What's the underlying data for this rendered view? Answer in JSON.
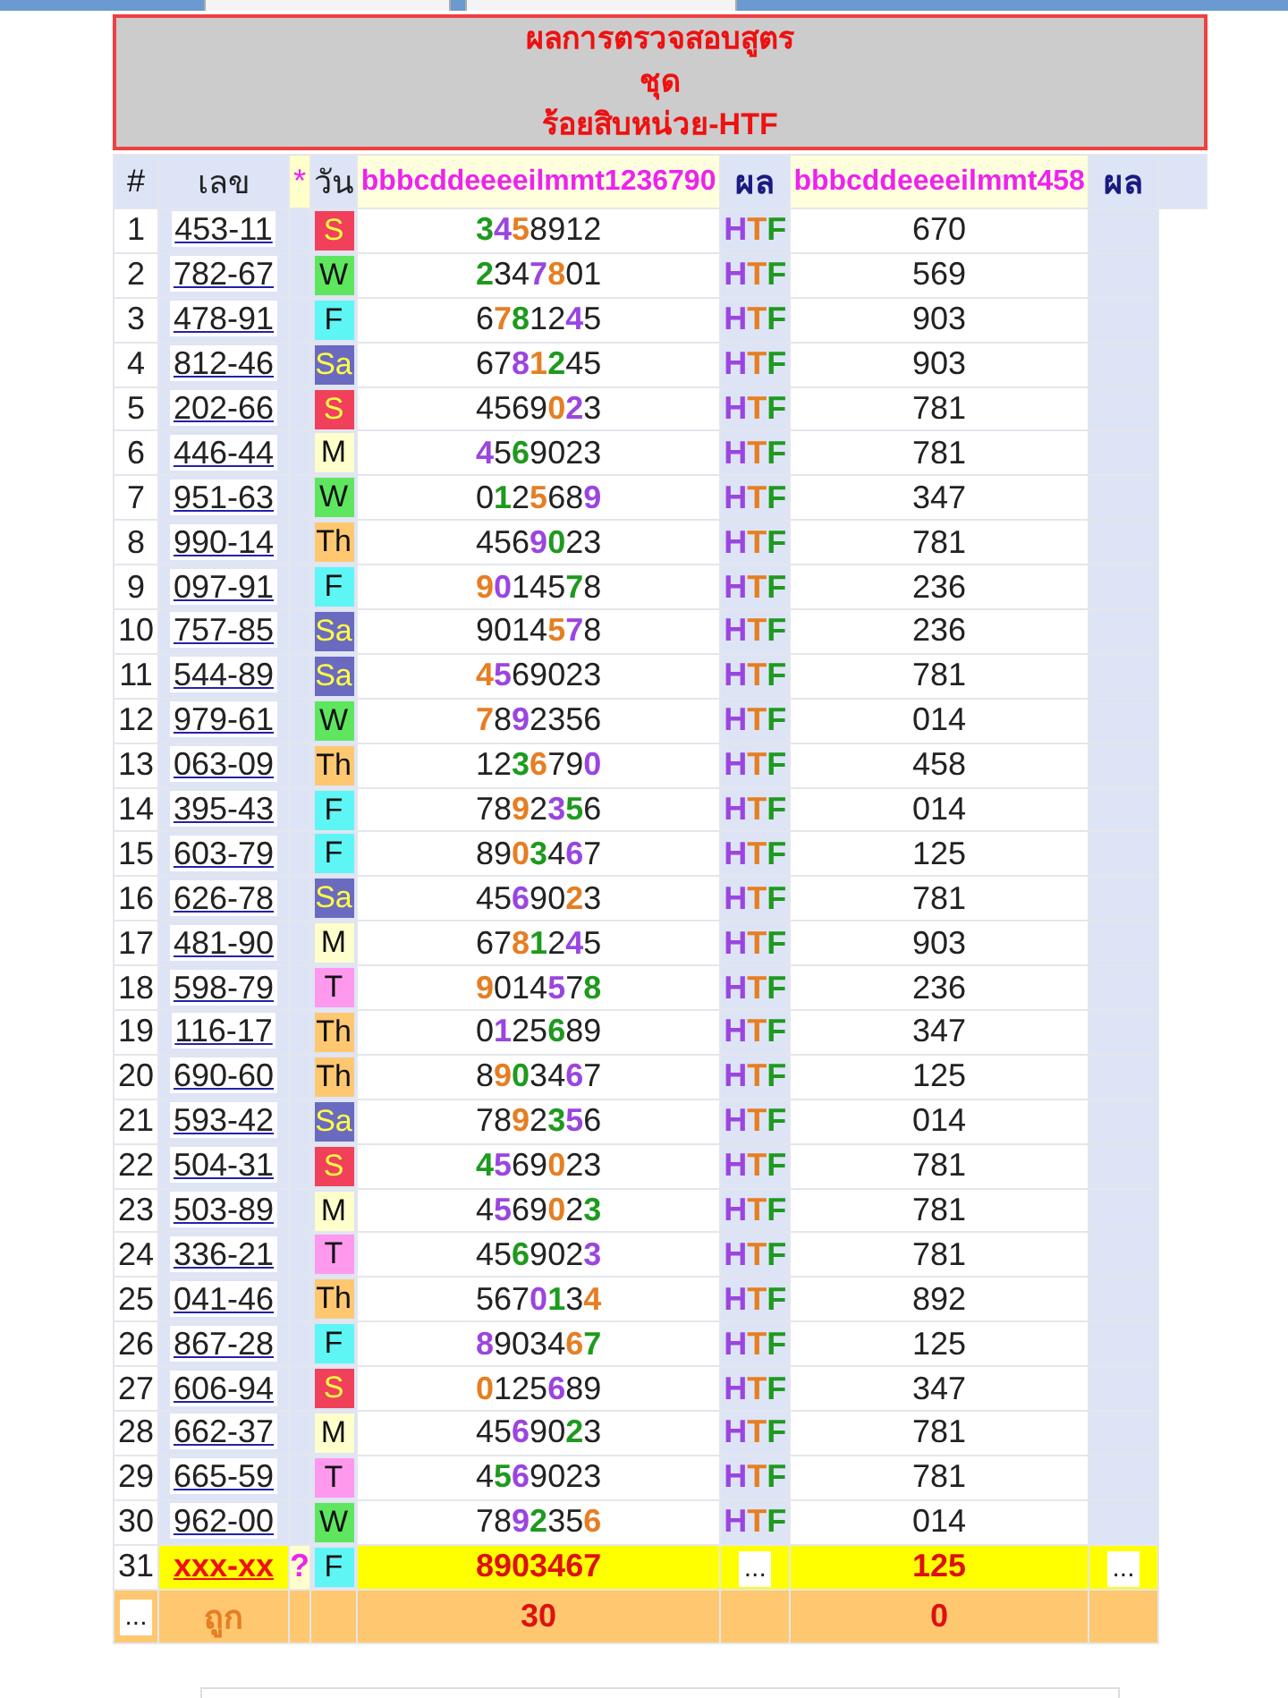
{
  "title": [
    "ผลการตรวจสอบสูตร",
    "ชุด",
    "ร้อยสิบหน่วย-HTF"
  ],
  "columns": [
    "#",
    "เลข",
    "*",
    "วัน",
    "bbbcddeeeeilmmt1236790",
    "ผล",
    "bbbcddeeeeilmmt458",
    "ผล"
  ],
  "rows": [
    {
      "n": "1",
      "number": "453-11",
      "day": {
        "label": "S",
        "color": "#f0405a"
      },
      "digits": [
        {
          "d": "3",
          "color": "#1e9a1e"
        },
        {
          "d": "4",
          "color": "#9b45e0"
        },
        {
          "d": "5",
          "color": "#e67e22"
        },
        {
          "d": "8"
        },
        {
          "d": "9"
        },
        {
          "d": "1"
        },
        {
          "d": "2"
        }
      ],
      "result": [
        {
          "d": "H",
          "color": "#9b45e0"
        },
        {
          "d": "T",
          "color": "#e67e22"
        },
        {
          "d": "F",
          "color": "#1e9a1e"
        }
      ],
      "value": "670"
    },
    {
      "n": "2",
      "number": "782-67",
      "day": {
        "label": "W",
        "color": "#5ee65e"
      },
      "digits": [
        {
          "d": "2",
          "color": "#1e9a1e"
        },
        {
          "d": "3"
        },
        {
          "d": "4"
        },
        {
          "d": "7",
          "color": "#9b45e0"
        },
        {
          "d": "8",
          "color": "#e67e22"
        },
        {
          "d": "0"
        },
        {
          "d": "1"
        }
      ],
      "result": [
        {
          "d": "H",
          "color": "#9b45e0"
        },
        {
          "d": "T",
          "color": "#e67e22"
        },
        {
          "d": "F",
          "color": "#1e9a1e"
        }
      ],
      "value": "569"
    },
    {
      "n": "3",
      "number": "478-91",
      "day": {
        "label": "F",
        "color": "#5ef5f5"
      },
      "digits": [
        {
          "d": "6"
        },
        {
          "d": "7",
          "color": "#e67e22"
        },
        {
          "d": "8",
          "color": "#1e9a1e"
        },
        {
          "d": "1"
        },
        {
          "d": "2"
        },
        {
          "d": "4",
          "color": "#9b45e0"
        },
        {
          "d": "5"
        }
      ],
      "result": [
        {
          "d": "H",
          "color": "#9b45e0"
        },
        {
          "d": "T",
          "color": "#e67e22"
        },
        {
          "d": "F",
          "color": "#1e9a1e"
        }
      ],
      "value": "903"
    },
    {
      "n": "4",
      "number": "812-46",
      "day": {
        "label": "Sa",
        "color": "#6a6ac0"
      },
      "digits": [
        {
          "d": "6"
        },
        {
          "d": "7"
        },
        {
          "d": "8",
          "color": "#9b45e0"
        },
        {
          "d": "1",
          "color": "#e67e22"
        },
        {
          "d": "2",
          "color": "#1e9a1e"
        },
        {
          "d": "4"
        },
        {
          "d": "5"
        }
      ],
      "result": [
        {
          "d": "H",
          "color": "#9b45e0"
        },
        {
          "d": "T",
          "color": "#e67e22"
        },
        {
          "d": "F",
          "color": "#1e9a1e"
        }
      ],
      "value": "903"
    },
    {
      "n": "5",
      "number": "202-66",
      "day": {
        "label": "S",
        "color": "#f0405a"
      },
      "digits": [
        {
          "d": "4"
        },
        {
          "d": "5"
        },
        {
          "d": "6"
        },
        {
          "d": "9"
        },
        {
          "d": "0",
          "color": "#e67e22"
        },
        {
          "d": "2",
          "color": "#9b45e0"
        },
        {
          "d": "3"
        }
      ],
      "result": [
        {
          "d": "H",
          "color": "#9b45e0"
        },
        {
          "d": "T",
          "color": "#e67e22"
        },
        {
          "d": "F",
          "color": "#1e9a1e"
        }
      ],
      "value": "781"
    },
    {
      "n": "6",
      "number": "446-44",
      "day": {
        "label": "M",
        "color": "#ffffcc"
      },
      "digits": [
        {
          "d": "4",
          "color": "#9b45e0"
        },
        {
          "d": "5"
        },
        {
          "d": "6",
          "color": "#1e9a1e"
        },
        {
          "d": "9"
        },
        {
          "d": "0"
        },
        {
          "d": "2"
        },
        {
          "d": "3"
        }
      ],
      "result": [
        {
          "d": "H",
          "color": "#9b45e0"
        },
        {
          "d": "T",
          "color": "#e67e22"
        },
        {
          "d": "F",
          "color": "#1e9a1e"
        }
      ],
      "value": "781"
    },
    {
      "n": "7",
      "number": "951-63",
      "day": {
        "label": "W",
        "color": "#5ee65e"
      },
      "digits": [
        {
          "d": "0"
        },
        {
          "d": "1",
          "color": "#1e9a1e"
        },
        {
          "d": "2"
        },
        {
          "d": "5",
          "color": "#e67e22"
        },
        {
          "d": "6"
        },
        {
          "d": "8"
        },
        {
          "d": "9",
          "color": "#9b45e0"
        }
      ],
      "result": [
        {
          "d": "H",
          "color": "#9b45e0"
        },
        {
          "d": "T",
          "color": "#e67e22"
        },
        {
          "d": "F",
          "color": "#1e9a1e"
        }
      ],
      "value": "347"
    },
    {
      "n": "8",
      "number": "990-14",
      "day": {
        "label": "Th",
        "color": "#ffc870"
      },
      "digits": [
        {
          "d": "4"
        },
        {
          "d": "5"
        },
        {
          "d": "6"
        },
        {
          "d": "9",
          "color": "#9b45e0"
        },
        {
          "d": "0",
          "color": "#1e9a1e"
        },
        {
          "d": "2"
        },
        {
          "d": "3"
        }
      ],
      "result": [
        {
          "d": "H",
          "color": "#9b45e0"
        },
        {
          "d": "T",
          "color": "#e67e22"
        },
        {
          "d": "F",
          "color": "#1e9a1e"
        }
      ],
      "value": "781"
    },
    {
      "n": "9",
      "number": "097-91",
      "day": {
        "label": "F",
        "color": "#5ef5f5"
      },
      "digits": [
        {
          "d": "9",
          "color": "#e67e22"
        },
        {
          "d": "0",
          "color": "#9b45e0"
        },
        {
          "d": "1"
        },
        {
          "d": "4"
        },
        {
          "d": "5"
        },
        {
          "d": "7",
          "color": "#1e9a1e"
        },
        {
          "d": "8"
        }
      ],
      "result": [
        {
          "d": "H",
          "color": "#9b45e0"
        },
        {
          "d": "T",
          "color": "#e67e22"
        },
        {
          "d": "F",
          "color": "#1e9a1e"
        }
      ],
      "value": "236"
    },
    {
      "n": "10",
      "number": "757-85",
      "day": {
        "label": "Sa",
        "color": "#6a6ac0"
      },
      "digits": [
        {
          "d": "9"
        },
        {
          "d": "0"
        },
        {
          "d": "1"
        },
        {
          "d": "4"
        },
        {
          "d": "5",
          "color": "#e67e22"
        },
        {
          "d": "7",
          "color": "#9b45e0"
        },
        {
          "d": "8"
        }
      ],
      "result": [
        {
          "d": "H",
          "color": "#9b45e0"
        },
        {
          "d": "T",
          "color": "#e67e22"
        },
        {
          "d": "F",
          "color": "#1e9a1e"
        }
      ],
      "value": "236"
    },
    {
      "n": "11",
      "number": "544-89",
      "day": {
        "label": "Sa",
        "color": "#6a6ac0"
      },
      "digits": [
        {
          "d": "4",
          "color": "#e67e22"
        },
        {
          "d": "5",
          "color": "#9b45e0"
        },
        {
          "d": "6"
        },
        {
          "d": "9"
        },
        {
          "d": "0"
        },
        {
          "d": "2"
        },
        {
          "d": "3"
        }
      ],
      "result": [
        {
          "d": "H",
          "color": "#9b45e0"
        },
        {
          "d": "T",
          "color": "#e67e22"
        },
        {
          "d": "F",
          "color": "#1e9a1e"
        }
      ],
      "value": "781"
    },
    {
      "n": "12",
      "number": "979-61",
      "day": {
        "label": "W",
        "color": "#5ee65e"
      },
      "digits": [
        {
          "d": "7",
          "color": "#e67e22"
        },
        {
          "d": "8"
        },
        {
          "d": "9",
          "color": "#9b45e0"
        },
        {
          "d": "2"
        },
        {
          "d": "3"
        },
        {
          "d": "5"
        },
        {
          "d": "6"
        }
      ],
      "result": [
        {
          "d": "H",
          "color": "#9b45e0"
        },
        {
          "d": "T",
          "color": "#e67e22"
        },
        {
          "d": "F",
          "color": "#1e9a1e"
        }
      ],
      "value": "014"
    },
    {
      "n": "13",
      "number": "063-09",
      "day": {
        "label": "Th",
        "color": "#ffc870"
      },
      "digits": [
        {
          "d": "1"
        },
        {
          "d": "2"
        },
        {
          "d": "3",
          "color": "#1e9a1e"
        },
        {
          "d": "6",
          "color": "#e67e22"
        },
        {
          "d": "7"
        },
        {
          "d": "9"
        },
        {
          "d": "0",
          "color": "#9b45e0"
        }
      ],
      "result": [
        {
          "d": "H",
          "color": "#9b45e0"
        },
        {
          "d": "T",
          "color": "#e67e22"
        },
        {
          "d": "F",
          "color": "#1e9a1e"
        }
      ],
      "value": "458"
    },
    {
      "n": "14",
      "number": "395-43",
      "day": {
        "label": "F",
        "color": "#5ef5f5"
      },
      "digits": [
        {
          "d": "7"
        },
        {
          "d": "8"
        },
        {
          "d": "9",
          "color": "#e67e22"
        },
        {
          "d": "2"
        },
        {
          "d": "3",
          "color": "#9b45e0"
        },
        {
          "d": "5",
          "color": "#1e9a1e"
        },
        {
          "d": "6"
        }
      ],
      "result": [
        {
          "d": "H",
          "color": "#9b45e0"
        },
        {
          "d": "T",
          "color": "#e67e22"
        },
        {
          "d": "F",
          "color": "#1e9a1e"
        }
      ],
      "value": "014"
    },
    {
      "n": "15",
      "number": "603-79",
      "day": {
        "label": "F",
        "color": "#5ef5f5"
      },
      "digits": [
        {
          "d": "8"
        },
        {
          "d": "9"
        },
        {
          "d": "0",
          "color": "#e67e22"
        },
        {
          "d": "3",
          "color": "#1e9a1e"
        },
        {
          "d": "4"
        },
        {
          "d": "6",
          "color": "#9b45e0"
        },
        {
          "d": "7"
        }
      ],
      "result": [
        {
          "d": "H",
          "color": "#9b45e0"
        },
        {
          "d": "T",
          "color": "#e67e22"
        },
        {
          "d": "F",
          "color": "#1e9a1e"
        }
      ],
      "value": "125"
    },
    {
      "n": "16",
      "number": "626-78",
      "day": {
        "label": "Sa",
        "color": "#6a6ac0"
      },
      "digits": [
        {
          "d": "4"
        },
        {
          "d": "5"
        },
        {
          "d": "6",
          "color": "#9b45e0"
        },
        {
          "d": "9"
        },
        {
          "d": "0"
        },
        {
          "d": "2",
          "color": "#e67e22"
        },
        {
          "d": "3"
        }
      ],
      "result": [
        {
          "d": "H",
          "color": "#9b45e0"
        },
        {
          "d": "T",
          "color": "#e67e22"
        },
        {
          "d": "F",
          "color": "#1e9a1e"
        }
      ],
      "value": "781"
    },
    {
      "n": "17",
      "number": "481-90",
      "day": {
        "label": "M",
        "color": "#ffffcc"
      },
      "digits": [
        {
          "d": "6"
        },
        {
          "d": "7"
        },
        {
          "d": "8",
          "color": "#e67e22"
        },
        {
          "d": "1",
          "color": "#1e9a1e"
        },
        {
          "d": "2"
        },
        {
          "d": "4",
          "color": "#9b45e0"
        },
        {
          "d": "5"
        }
      ],
      "result": [
        {
          "d": "H",
          "color": "#9b45e0"
        },
        {
          "d": "T",
          "color": "#e67e22"
        },
        {
          "d": "F",
          "color": "#1e9a1e"
        }
      ],
      "value": "903"
    },
    {
      "n": "18",
      "number": "598-79",
      "day": {
        "label": "T",
        "color": "#ff99ee"
      },
      "digits": [
        {
          "d": "9",
          "color": "#e67e22"
        },
        {
          "d": "0"
        },
        {
          "d": "1"
        },
        {
          "d": "4"
        },
        {
          "d": "5",
          "color": "#9b45e0"
        },
        {
          "d": "7"
        },
        {
          "d": "8",
          "color": "#1e9a1e"
        }
      ],
      "result": [
        {
          "d": "H",
          "color": "#9b45e0"
        },
        {
          "d": "T",
          "color": "#e67e22"
        },
        {
          "d": "F",
          "color": "#1e9a1e"
        }
      ],
      "value": "236"
    },
    {
      "n": "19",
      "number": "116-17",
      "day": {
        "label": "Th",
        "color": "#ffc870"
      },
      "digits": [
        {
          "d": "0"
        },
        {
          "d": "1",
          "color": "#9b45e0"
        },
        {
          "d": "2"
        },
        {
          "d": "5"
        },
        {
          "d": "6",
          "color": "#1e9a1e"
        },
        {
          "d": "8"
        },
        {
          "d": "9"
        }
      ],
      "result": [
        {
          "d": "H",
          "color": "#9b45e0"
        },
        {
          "d": "T",
          "color": "#e67e22"
        },
        {
          "d": "F",
          "color": "#1e9a1e"
        }
      ],
      "value": "347"
    },
    {
      "n": "20",
      "number": "690-60",
      "day": {
        "label": "Th",
        "color": "#ffc870"
      },
      "digits": [
        {
          "d": "8"
        },
        {
          "d": "9",
          "color": "#e67e22"
        },
        {
          "d": "0",
          "color": "#1e9a1e"
        },
        {
          "d": "3"
        },
        {
          "d": "4"
        },
        {
          "d": "6",
          "color": "#9b45e0"
        },
        {
          "d": "7"
        }
      ],
      "result": [
        {
          "d": "H",
          "color": "#9b45e0"
        },
        {
          "d": "T",
          "color": "#e67e22"
        },
        {
          "d": "F",
          "color": "#1e9a1e"
        }
      ],
      "value": "125"
    },
    {
      "n": "21",
      "number": "593-42",
      "day": {
        "label": "Sa",
        "color": "#6a6ac0"
      },
      "digits": [
        {
          "d": "7"
        },
        {
          "d": "8"
        },
        {
          "d": "9",
          "color": "#e67e22"
        },
        {
          "d": "2"
        },
        {
          "d": "3",
          "color": "#1e9a1e"
        },
        {
          "d": "5",
          "color": "#9b45e0"
        },
        {
          "d": "6"
        }
      ],
      "result": [
        {
          "d": "H",
          "color": "#9b45e0"
        },
        {
          "d": "T",
          "color": "#e67e22"
        },
        {
          "d": "F",
          "color": "#1e9a1e"
        }
      ],
      "value": "014"
    },
    {
      "n": "22",
      "number": "504-31",
      "day": {
        "label": "S",
        "color": "#f0405a"
      },
      "digits": [
        {
          "d": "4",
          "color": "#1e9a1e"
        },
        {
          "d": "5",
          "color": "#9b45e0"
        },
        {
          "d": "6"
        },
        {
          "d": "9"
        },
        {
          "d": "0",
          "color": "#e67e22"
        },
        {
          "d": "2"
        },
        {
          "d": "3"
        }
      ],
      "result": [
        {
          "d": "H",
          "color": "#9b45e0"
        },
        {
          "d": "T",
          "color": "#e67e22"
        },
        {
          "d": "F",
          "color": "#1e9a1e"
        }
      ],
      "value": "781"
    },
    {
      "n": "23",
      "number": "503-89",
      "day": {
        "label": "M",
        "color": "#ffffcc"
      },
      "digits": [
        {
          "d": "4"
        },
        {
          "d": "5",
          "color": "#9b45e0"
        },
        {
          "d": "6"
        },
        {
          "d": "9"
        },
        {
          "d": "0",
          "color": "#e67e22"
        },
        {
          "d": "2"
        },
        {
          "d": "3",
          "color": "#1e9a1e"
        }
      ],
      "result": [
        {
          "d": "H",
          "color": "#9b45e0"
        },
        {
          "d": "T",
          "color": "#e67e22"
        },
        {
          "d": "F",
          "color": "#1e9a1e"
        }
      ],
      "value": "781"
    },
    {
      "n": "24",
      "number": "336-21",
      "day": {
        "label": "T",
        "color": "#ff99ee"
      },
      "digits": [
        {
          "d": "4"
        },
        {
          "d": "5"
        },
        {
          "d": "6",
          "color": "#1e9a1e"
        },
        {
          "d": "9"
        },
        {
          "d": "0"
        },
        {
          "d": "2"
        },
        {
          "d": "3",
          "color": "#9b45e0"
        }
      ],
      "result": [
        {
          "d": "H",
          "color": "#9b45e0"
        },
        {
          "d": "T",
          "color": "#e67e22"
        },
        {
          "d": "F",
          "color": "#1e9a1e"
        }
      ],
      "value": "781"
    },
    {
      "n": "25",
      "number": "041-46",
      "day": {
        "label": "Th",
        "color": "#ffc870"
      },
      "digits": [
        {
          "d": "5"
        },
        {
          "d": "6"
        },
        {
          "d": "7"
        },
        {
          "d": "0",
          "color": "#9b45e0"
        },
        {
          "d": "1",
          "color": "#1e9a1e"
        },
        {
          "d": "3"
        },
        {
          "d": "4",
          "color": "#e67e22"
        }
      ],
      "result": [
        {
          "d": "H",
          "color": "#9b45e0"
        },
        {
          "d": "T",
          "color": "#e67e22"
        },
        {
          "d": "F",
          "color": "#1e9a1e"
        }
      ],
      "value": "892"
    },
    {
      "n": "26",
      "number": "867-28",
      "day": {
        "label": "F",
        "color": "#5ef5f5"
      },
      "digits": [
        {
          "d": "8",
          "color": "#9b45e0"
        },
        {
          "d": "9"
        },
        {
          "d": "0"
        },
        {
          "d": "3"
        },
        {
          "d": "4"
        },
        {
          "d": "6",
          "color": "#e67e22"
        },
        {
          "d": "7",
          "color": "#1e9a1e"
        }
      ],
      "result": [
        {
          "d": "H",
          "color": "#9b45e0"
        },
        {
          "d": "T",
          "color": "#e67e22"
        },
        {
          "d": "F",
          "color": "#1e9a1e"
        }
      ],
      "value": "125"
    },
    {
      "n": "27",
      "number": "606-94",
      "day": {
        "label": "S",
        "color": "#f0405a"
      },
      "digits": [
        {
          "d": "0",
          "color": "#e67e22"
        },
        {
          "d": "1"
        },
        {
          "d": "2"
        },
        {
          "d": "5"
        },
        {
          "d": "6",
          "color": "#9b45e0"
        },
        {
          "d": "8"
        },
        {
          "d": "9"
        }
      ],
      "result": [
        {
          "d": "H",
          "color": "#9b45e0"
        },
        {
          "d": "T",
          "color": "#e67e22"
        },
        {
          "d": "F",
          "color": "#1e9a1e"
        }
      ],
      "value": "347"
    },
    {
      "n": "28",
      "number": "662-37",
      "day": {
        "label": "M",
        "color": "#ffffcc"
      },
      "digits": [
        {
          "d": "4"
        },
        {
          "d": "5"
        },
        {
          "d": "6",
          "color": "#9b45e0"
        },
        {
          "d": "9"
        },
        {
          "d": "0"
        },
        {
          "d": "2",
          "color": "#1e9a1e"
        },
        {
          "d": "3"
        }
      ],
      "result": [
        {
          "d": "H",
          "color": "#9b45e0"
        },
        {
          "d": "T",
          "color": "#e67e22"
        },
        {
          "d": "F",
          "color": "#1e9a1e"
        }
      ],
      "value": "781"
    },
    {
      "n": "29",
      "number": "665-59",
      "day": {
        "label": "T",
        "color": "#ff99ee"
      },
      "digits": [
        {
          "d": "4"
        },
        {
          "d": "5",
          "color": "#1e9a1e"
        },
        {
          "d": "6",
          "color": "#9b45e0"
        },
        {
          "d": "9"
        },
        {
          "d": "0"
        },
        {
          "d": "2"
        },
        {
          "d": "3"
        }
      ],
      "result": [
        {
          "d": "H",
          "color": "#9b45e0"
        },
        {
          "d": "T",
          "color": "#e67e22"
        },
        {
          "d": "F",
          "color": "#1e9a1e"
        }
      ],
      "value": "781"
    },
    {
      "n": "30",
      "number": "962-00",
      "day": {
        "label": "W",
        "color": "#5ee65e"
      },
      "digits": [
        {
          "d": "7"
        },
        {
          "d": "8"
        },
        {
          "d": "9",
          "color": "#9b45e0"
        },
        {
          "d": "2",
          "color": "#1e9a1e"
        },
        {
          "d": "3"
        },
        {
          "d": "5"
        },
        {
          "d": "6",
          "color": "#e67e22"
        }
      ],
      "result": [
        {
          "d": "H",
          "color": "#9b45e0"
        },
        {
          "d": "T",
          "color": "#e67e22"
        },
        {
          "d": "F",
          "color": "#1e9a1e"
        }
      ],
      "value": "014"
    }
  ],
  "pending": {
    "n": "31",
    "number": "xxx-xx",
    "mark": "?",
    "day": {
      "label": "F",
      "color": "#5ef5f5"
    },
    "digits": "8903467",
    "result": "...",
    "value": "125",
    "last": "..."
  },
  "summary": {
    "first": "...",
    "label": "ถูก",
    "hits": "30",
    "value": "0"
  }
}
